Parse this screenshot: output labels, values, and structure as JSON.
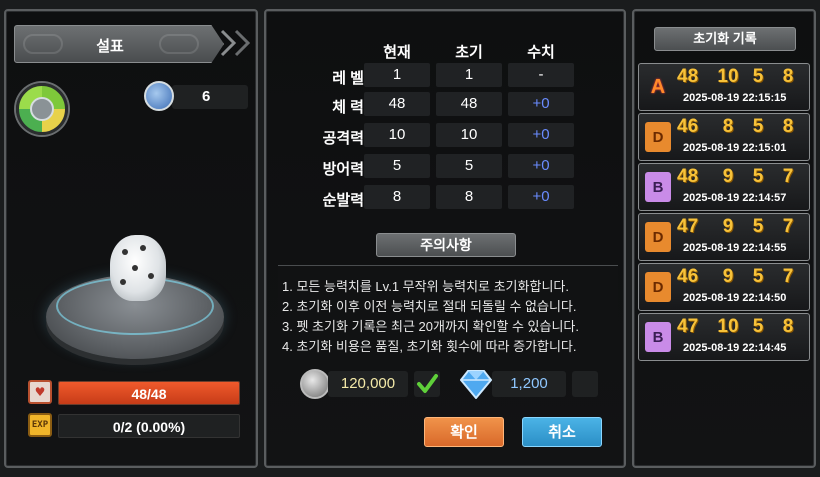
{
  "pet": {
    "name": "설표",
    "level": "6",
    "hp_text": "48/48",
    "hp_fraction": 1.0,
    "exp_text": "0/2 (0.00%)",
    "exp_icon": "EXP"
  },
  "stats": {
    "headers": [
      "현재",
      "초기",
      "수치"
    ],
    "rows": [
      {
        "label": "레 벨",
        "current": "1",
        "initial": "1",
        "diff": "-"
      },
      {
        "label": "체 력",
        "current": "48",
        "initial": "48",
        "diff": "+0"
      },
      {
        "label": "공격력",
        "current": "10",
        "initial": "10",
        "diff": "+0"
      },
      {
        "label": "방어력",
        "current": "5",
        "initial": "5",
        "diff": "+0"
      },
      {
        "label": "순발력",
        "current": "8",
        "initial": "8",
        "diff": "+0"
      }
    ]
  },
  "notice": {
    "title": "주의사항",
    "lines": [
      "1. 모든 능력치를 Lv.1 무작위 능력치로 초기화합니다.",
      "2. 초기화 이후 이전 능력치로 절대 되돌릴 수 없습니다.",
      "3. 펫 초기화 기록은 최근 20개까지 확인할 수 있습니다.",
      "4. 초기화 비용은 품질, 초기화 횟수에 따라 증가합니다."
    ]
  },
  "cost": {
    "coin": "120,000",
    "gem": "1,200"
  },
  "buttons": {
    "confirm": "확인",
    "cancel": "취소"
  },
  "history": {
    "title": "초기화 기록",
    "items": [
      {
        "grade": "A",
        "values": [
          "48",
          "10",
          "5",
          "8"
        ],
        "date": "2025-08-19 22:15:15"
      },
      {
        "grade": "D",
        "values": [
          "46",
          "8",
          "5",
          "8"
        ],
        "date": "2025-08-19 22:15:01"
      },
      {
        "grade": "B",
        "values": [
          "48",
          "9",
          "5",
          "7"
        ],
        "date": "2025-08-19 22:14:57"
      },
      {
        "grade": "D",
        "values": [
          "47",
          "9",
          "5",
          "7"
        ],
        "date": "2025-08-19 22:14:55"
      },
      {
        "grade": "D",
        "values": [
          "46",
          "9",
          "5",
          "7"
        ],
        "date": "2025-08-19 22:14:50"
      },
      {
        "grade": "B",
        "values": [
          "47",
          "10",
          "5",
          "8"
        ],
        "date": "2025-08-19 22:14:45"
      }
    ]
  },
  "colors": {
    "hp_bar": "#e0502a",
    "diff_blue": "#6a8cff",
    "history_numbers": "#f7c23a",
    "confirm_button": "#e47a36",
    "cancel_button": "#3aa2d8"
  }
}
